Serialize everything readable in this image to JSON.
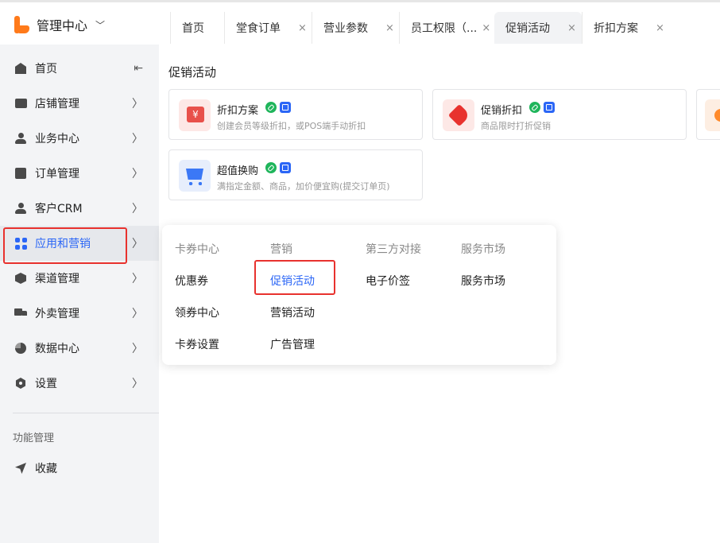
{
  "header": {
    "title": "管理中心",
    "tabs": [
      {
        "label": "首页",
        "closable": false,
        "active": false
      },
      {
        "label": "堂食订单",
        "closable": true,
        "active": false
      },
      {
        "label": "营业参数",
        "closable": true,
        "active": false
      },
      {
        "label": "员工权限（...",
        "closable": true,
        "active": false
      },
      {
        "label": "促销活动",
        "closable": true,
        "active": true
      },
      {
        "label": "折扣方案",
        "closable": true,
        "active": false
      }
    ],
    "close_glyph": "×"
  },
  "sidebar": {
    "items": [
      {
        "label": "首页",
        "icon": "home-icon",
        "trailing": "collapse-icon"
      },
      {
        "label": "店铺管理",
        "icon": "store-icon",
        "trailing": "chevron-right-icon"
      },
      {
        "label": "业务中心",
        "icon": "business-icon",
        "trailing": "chevron-right-icon"
      },
      {
        "label": "订单管理",
        "icon": "order-icon",
        "trailing": "chevron-right-icon"
      },
      {
        "label": "客户CRM",
        "icon": "customer-icon",
        "trailing": "chevron-right-icon"
      },
      {
        "label": "应用和营销",
        "icon": "apps-icon",
        "trailing": "chevron-right-icon",
        "active": true
      },
      {
        "label": "渠道管理",
        "icon": "channel-icon",
        "trailing": "chevron-right-icon"
      },
      {
        "label": "外卖管理",
        "icon": "delivery-icon",
        "trailing": "chevron-right-icon"
      },
      {
        "label": "数据中心",
        "icon": "data-icon",
        "trailing": "chevron-right-icon"
      },
      {
        "label": "设置",
        "icon": "settings-icon",
        "trailing": "chevron-right-icon"
      }
    ],
    "section_title": "功能管理",
    "extra_items": [
      {
        "label": "收藏",
        "icon": "favorite-icon"
      }
    ]
  },
  "main": {
    "title": "促销活动",
    "cards": [
      {
        "title": "折扣方案",
        "desc": "创建会员等级折扣，或POS端手动折扣",
        "icon": "discount-ticket-icon"
      },
      {
        "title": "促销折扣",
        "desc": "商品限时打折促销",
        "icon": "sale-tag-icon"
      },
      {
        "title": "超值换购",
        "desc": "满指定金额、商品，加价便宜购(提交订单页)",
        "icon": "shopping-cart-icon"
      }
    ]
  },
  "flyout": {
    "columns": [
      {
        "heading": "卡券中心",
        "items": [
          "优惠券",
          "领券中心",
          "卡券设置"
        ]
      },
      {
        "heading": "营销",
        "items": [
          "促销活动",
          "营销活动",
          "广告管理"
        ]
      },
      {
        "heading": "第三方对接",
        "items": [
          "电子价签"
        ]
      },
      {
        "heading": "服务市场",
        "items": [
          "服务市场"
        ]
      }
    ],
    "active_item": "促销活动"
  },
  "colors": {
    "accent": "#2b66f6",
    "highlight": "#e8322e",
    "brand": "#ff7a1a"
  }
}
